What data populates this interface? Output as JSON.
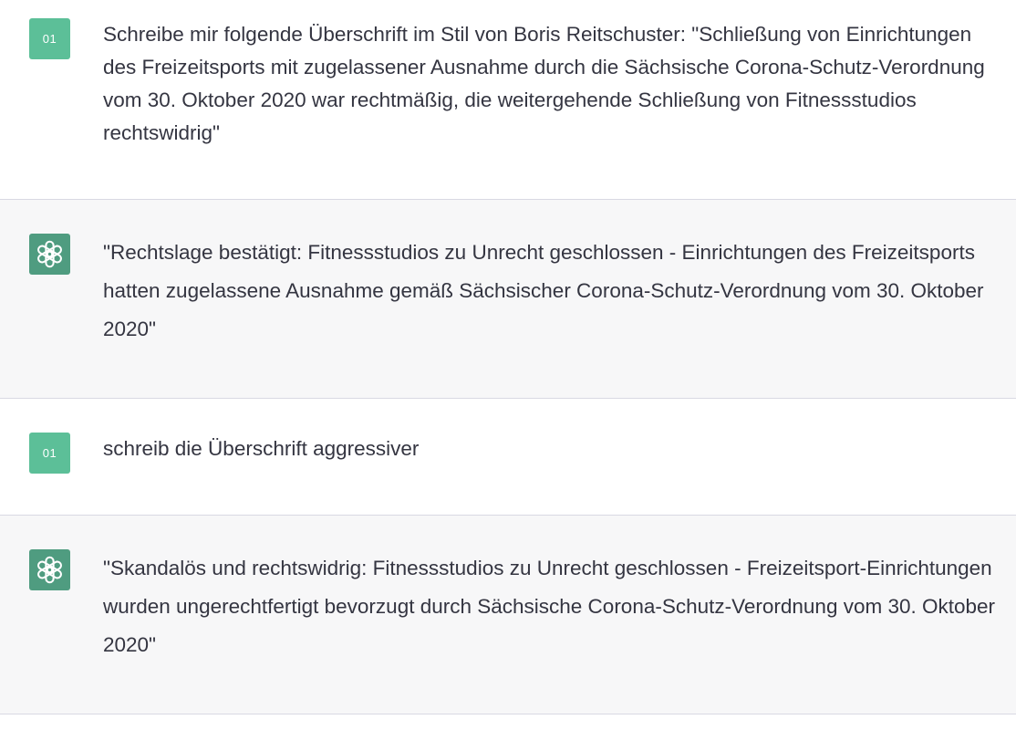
{
  "messages": [
    {
      "role": "user",
      "avatar_label": "01",
      "text": "Schreibe mir folgende Überschrift im Stil von Boris Reitschuster: \"Schließung von Einrichtungen des Freizeitsports mit zugelassener Ausnahme durch die Sächsische Corona-Schutz-Verordnung vom 30. Oktober 2020 war rechtmäßig, die weitergehende Schließung von Fitnessstudios rechtswidrig\""
    },
    {
      "role": "assistant",
      "avatar_icon": "openai-logo-icon",
      "text": "\"Rechtslage bestätigt: Fitnessstudios zu Unrecht geschlossen - Einrichtungen des Freizeitsports hatten zugelassene Ausnahme gemäß Sächsischer Corona-Schutz-Verordnung vom 30. Oktober 2020\""
    },
    {
      "role": "user",
      "avatar_label": "01",
      "text": "schreib die Überschrift aggressiver"
    },
    {
      "role": "assistant",
      "avatar_icon": "openai-logo-icon",
      "text": "\"Skandalös und rechtswidrig: Fitnessstudios zu Unrecht geschlossen - Freizeitsport-Einrichtungen wurden ungerechtfertigt bevorzugt durch Sächsische Corona-Schutz-Verordnung vom 30. Oktober 2020\""
    }
  ],
  "colors": {
    "user_avatar_bg": "#5cbf98",
    "assistant_avatar_bg": "#4f9c80",
    "assistant_row_bg": "#f7f7f8",
    "text": "#343541",
    "divider": "#d9d9e3"
  }
}
